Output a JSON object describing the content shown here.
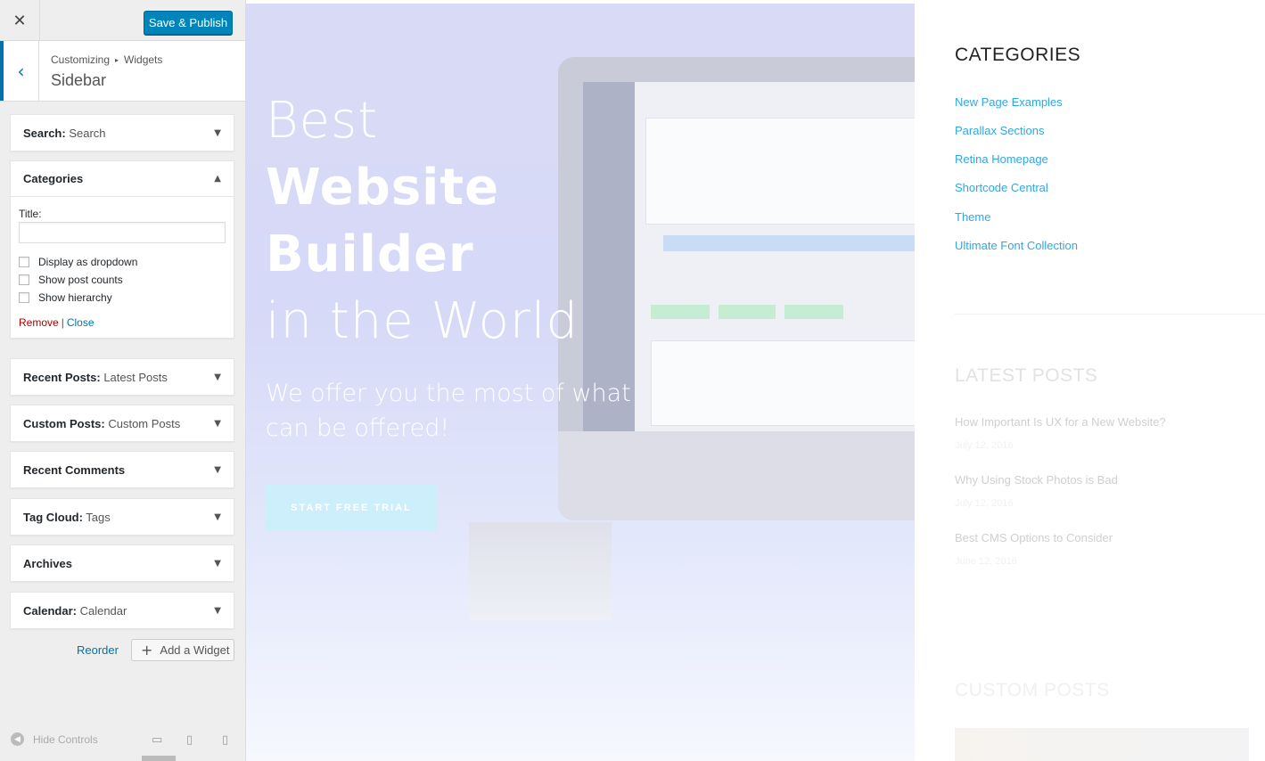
{
  "customizer": {
    "close_glyph": "✕",
    "publish_label": "Save & Publish",
    "back_glyph": "‹",
    "breadcrumb": {
      "root": "Customizing",
      "separator": "▸",
      "current": "Widgets"
    },
    "section_name": "Sidebar",
    "widgets": [
      {
        "title": "Search:",
        "subtitle": " Search",
        "arrow": "▼"
      },
      {
        "title": "Categories",
        "subtitle": "",
        "arrow": "▲"
      },
      {
        "title": "Recent Posts:",
        "subtitle": " Latest Posts",
        "arrow": "▼"
      },
      {
        "title": "Custom Posts:",
        "subtitle": " Custom Posts",
        "arrow": "▼"
      },
      {
        "title": "Recent Comments",
        "subtitle": "",
        "arrow": "▼"
      },
      {
        "title": "Tag Cloud:",
        "subtitle": " Tags",
        "arrow": "▼"
      },
      {
        "title": "Archives",
        "subtitle": "",
        "arrow": "▼"
      },
      {
        "title": "Calendar:",
        "subtitle": " Calendar",
        "arrow": "▼"
      }
    ],
    "categories_form": {
      "title_label": "Title:",
      "title_value": "",
      "options": [
        {
          "label": "Display as dropdown",
          "checked": false
        },
        {
          "label": "Show post counts",
          "checked": false
        },
        {
          "label": "Show hierarchy",
          "checked": false
        }
      ],
      "remove_label": "Remove",
      "pipe": "|",
      "close_label": "Close"
    },
    "reorder_label": "Reorder",
    "add_widget_label": "Add a Widget",
    "add_glyph": "+",
    "footer": {
      "hide_controls_label": "Hide Controls",
      "hide_glyph": "◀",
      "desktop_glyph": "▭",
      "tablet_glyph": "▯",
      "mobile_glyph": "▯"
    }
  },
  "preview": {
    "hero": {
      "line1": "Best",
      "line2": "Website",
      "line3": "Builder",
      "line4": "in the World",
      "subtitle": "We offer you the most of what can be offered!",
      "cta_label": "START FREE TRIAL"
    },
    "sidebar": {
      "categories_heading": "CATEGORIES",
      "categories": [
        "New Page Examples",
        "Parallax Sections",
        "Retina Homepage",
        "Shortcode Central",
        "Theme",
        "Ultimate Font Collection"
      ],
      "latest_heading": "LATEST POSTS",
      "latest_posts": [
        {
          "title": "How Important Is UX for a New Website?",
          "date": "July 12, 2016"
        },
        {
          "title": "Why Using Stock Photos is Bad",
          "date": "July 12, 2016"
        },
        {
          "title": "Best CMS Options to Consider",
          "date": "June 12, 2016"
        }
      ],
      "custom_heading": "CUSTOM POSTS"
    }
  },
  "colors": {
    "accent": "#0073aa",
    "publish": "#0085ba",
    "link": "#2fa8e2",
    "remove": "#aa0000"
  }
}
